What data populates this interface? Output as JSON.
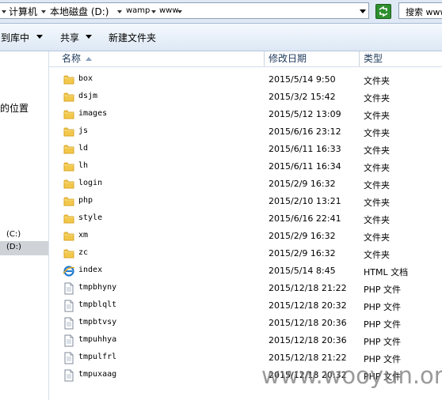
{
  "address_bar": {
    "crumbs": [
      "计算机",
      "本地磁盘 (D:)",
      "wamp",
      "www"
    ],
    "search_placeholder": "搜索 www"
  },
  "toolbar": {
    "library_label": "到库中",
    "share_label": "共享",
    "new_folder_label": "新建文件夹"
  },
  "nav": {
    "recent_places": "的位置",
    "drive_c": "(C:)",
    "drive_d": "(D:)"
  },
  "columns": {
    "name": "名称",
    "date": "修改日期",
    "type": "类型"
  },
  "files": [
    {
      "name": "box",
      "date": "2015/5/14 9:50",
      "type": "文件夹",
      "icon": "folder-icon"
    },
    {
      "name": "dsjm",
      "date": "2015/3/2 15:42",
      "type": "文件夹",
      "icon": "folder-icon"
    },
    {
      "name": "images",
      "date": "2015/5/12 13:09",
      "type": "文件夹",
      "icon": "folder-icon"
    },
    {
      "name": "js",
      "date": "2015/6/16 23:12",
      "type": "文件夹",
      "icon": "folder-icon"
    },
    {
      "name": "ld",
      "date": "2015/6/11 16:33",
      "type": "文件夹",
      "icon": "folder-icon"
    },
    {
      "name": "lh",
      "date": "2015/6/11 16:34",
      "type": "文件夹",
      "icon": "folder-icon"
    },
    {
      "name": "login",
      "date": "2015/2/9 16:32",
      "type": "文件夹",
      "icon": "folder-icon"
    },
    {
      "name": "php",
      "date": "2015/2/10 13:21",
      "type": "文件夹",
      "icon": "folder-icon"
    },
    {
      "name": "style",
      "date": "2015/6/16 22:41",
      "type": "文件夹",
      "icon": "folder-icon"
    },
    {
      "name": "xm",
      "date": "2015/2/9 16:32",
      "type": "文件夹",
      "icon": "folder-icon"
    },
    {
      "name": "zc",
      "date": "2015/2/9 16:32",
      "type": "文件夹",
      "icon": "folder-icon"
    },
    {
      "name": "index",
      "date": "2015/5/14 8:45",
      "type": "HTML 文档",
      "icon": "ie-html-icon"
    },
    {
      "name": "tmpbhyny",
      "date": "2015/12/18 21:22",
      "type": "PHP 文件",
      "icon": "file-icon"
    },
    {
      "name": "tmpblqlt",
      "date": "2015/12/18 20:32",
      "type": "PHP 文件",
      "icon": "file-icon"
    },
    {
      "name": "tmpbtvsy",
      "date": "2015/12/18 20:36",
      "type": "PHP 文件",
      "icon": "file-icon"
    },
    {
      "name": "tmpuhhya",
      "date": "2015/12/18 20:36",
      "type": "PHP 文件",
      "icon": "file-icon"
    },
    {
      "name": "tmpulfrl",
      "date": "2015/12/18 21:22",
      "type": "PHP 文件",
      "icon": "file-icon"
    },
    {
      "name": "tmpuxaag",
      "date": "2015/12/18 20:32",
      "type": "PHP 文件",
      "icon": "file-icon"
    }
  ],
  "watermark": "www.wooyun.org",
  "colors": {
    "folder": "#f2c84b",
    "folder_dark": "#d9a526",
    "refresh": "#2f8f2f",
    "header_text": "#1e395b"
  }
}
